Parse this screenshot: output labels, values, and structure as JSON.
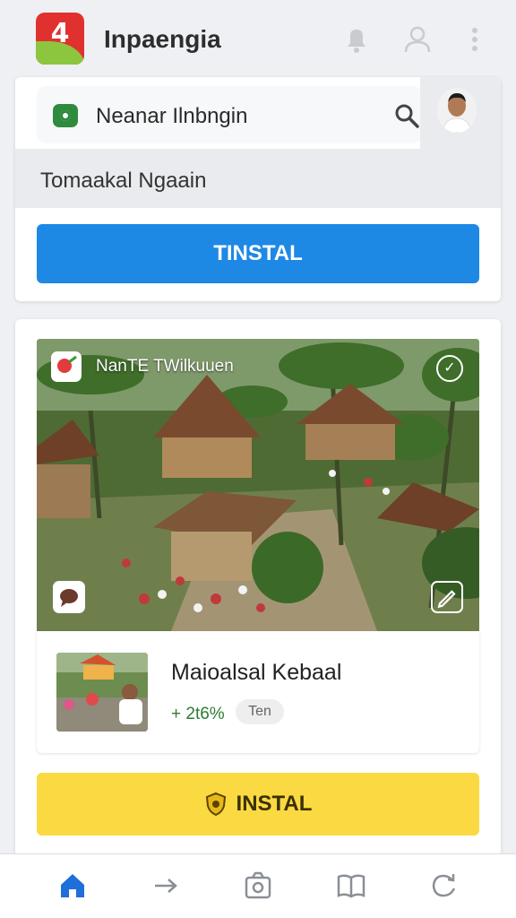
{
  "app": {
    "title": "Inpaengia"
  },
  "search": {
    "query": "Neanar Ilnbngin"
  },
  "section": {
    "title": "Tomaakal Ngaain"
  },
  "primary_button": {
    "label": "TINSTAL"
  },
  "feature": {
    "hero_label": "NanTE TWilkuuen",
    "app_name": "Maioalsal Kebaal",
    "rating": "+ 2t6%",
    "tag": "Ten",
    "install_label": "INSTAL"
  },
  "colors": {
    "accent_blue": "#1e88e5",
    "accent_yellow": "#fbd943",
    "logo_red": "#e0312f",
    "logo_green": "#8cc63f",
    "active_nav": "#1e6fd9",
    "rating_green": "#2e7d32"
  },
  "icons": {
    "top_bar": [
      "notification-icon",
      "account-icon",
      "more-vert-icon"
    ],
    "bottom_nav": [
      "home-icon",
      "arrow-forward-icon",
      "camera-icon",
      "book-icon",
      "refresh-icon"
    ]
  }
}
